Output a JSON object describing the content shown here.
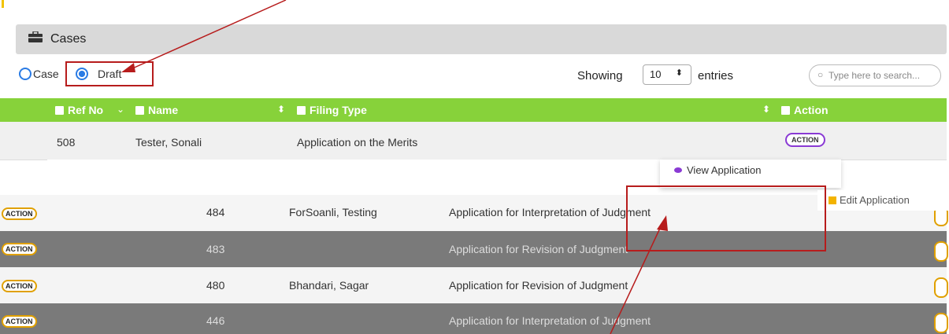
{
  "panel": {
    "title": "Cases"
  },
  "filter": {
    "case_label": "Case",
    "draft_label": "Draft",
    "selected": "Draft"
  },
  "length": {
    "showing_label": "Showing",
    "value": "10",
    "entries_label": "entries"
  },
  "search": {
    "placeholder": "Type here to search..."
  },
  "table": {
    "headers": {
      "ref": "Ref No",
      "name": "Name",
      "filing": "Filing Type",
      "action": "Action"
    },
    "rows": [
      {
        "ref": "508",
        "name": "Tester, Sonali",
        "filing": "Application on the Merits",
        "action": "ACTION"
      },
      {
        "ref": "484",
        "name": "ForSoanli, Testing",
        "filing": "Application for Interpretation of Judgment",
        "action": "ACTION"
      },
      {
        "ref": "483",
        "name": "",
        "filing": "Application for Revision of Judgment",
        "action": "ACTION"
      },
      {
        "ref": "480",
        "name": "Bhandari, Sagar",
        "filing": "Application for Revision of Judgment",
        "action": "ACTION"
      },
      {
        "ref": "446",
        "name": "",
        "filing": "Application for Interpretation of Judgment",
        "action": "ACTION"
      }
    ]
  },
  "dropdown": {
    "view": "View Application",
    "edit": "Edit Application"
  },
  "colors": {
    "header_green": "#87d23a",
    "accent_purple": "#8a3ad4",
    "annotation_red": "#b71c1c"
  }
}
